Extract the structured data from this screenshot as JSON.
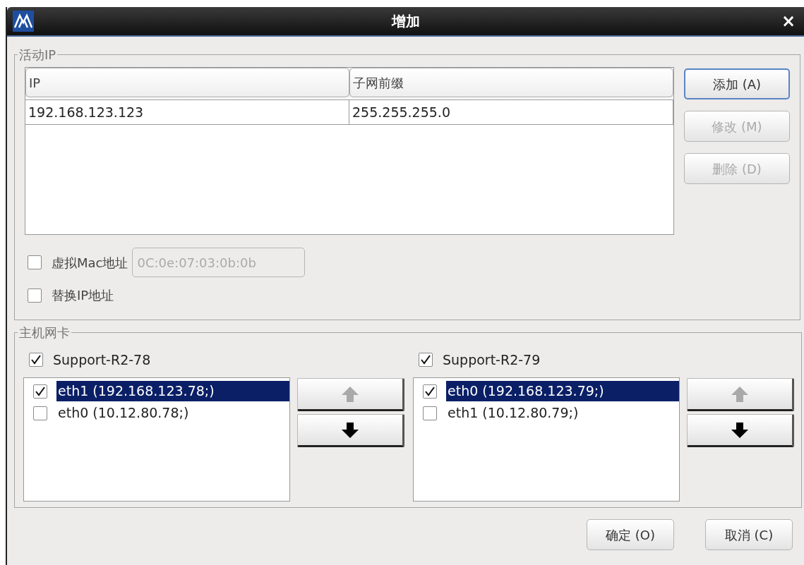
{
  "window": {
    "title": "增加",
    "close": "×"
  },
  "active_ip": {
    "title": "活动IP",
    "table": {
      "columns": [
        "IP",
        "子网前缀"
      ],
      "rows": [
        [
          "192.168.123.123",
          "255.255.255.0"
        ]
      ]
    },
    "buttons": [
      {
        "label": "添加 (A)",
        "disabled": false,
        "focused": true
      },
      {
        "label": "修改 (M)",
        "disabled": true,
        "focused": false
      },
      {
        "label": "删除 (D)",
        "disabled": true,
        "focused": false
      }
    ],
    "virtual_mac": {
      "label": "虚拟Mac地址",
      "checked": false,
      "value": "0C:0e:07:03:0b:0b",
      "disabled": true
    },
    "replace_ip": {
      "label": "替换IP地址",
      "checked": false
    }
  },
  "host_nics": {
    "title": "主机网卡",
    "hosts": [
      {
        "name": "Support-R2-78",
        "checked": true,
        "up_disabled": true,
        "down_disabled": false,
        "interfaces": [
          {
            "label": "eth1 (192.168.123.78;)",
            "checked": true,
            "selected": true
          },
          {
            "label": "eth0 (10.12.80.78;)",
            "checked": false,
            "selected": false
          }
        ]
      },
      {
        "name": "Support-R2-79",
        "checked": true,
        "up_disabled": true,
        "down_disabled": false,
        "interfaces": [
          {
            "label": "eth0 (192.168.123.79;)",
            "checked": true,
            "selected": true
          },
          {
            "label": "eth1 (10.12.80.79;)",
            "checked": false,
            "selected": false
          }
        ]
      }
    ]
  },
  "footer": {
    "buttons": [
      "确定 (O)",
      "取消 (C)"
    ]
  }
}
